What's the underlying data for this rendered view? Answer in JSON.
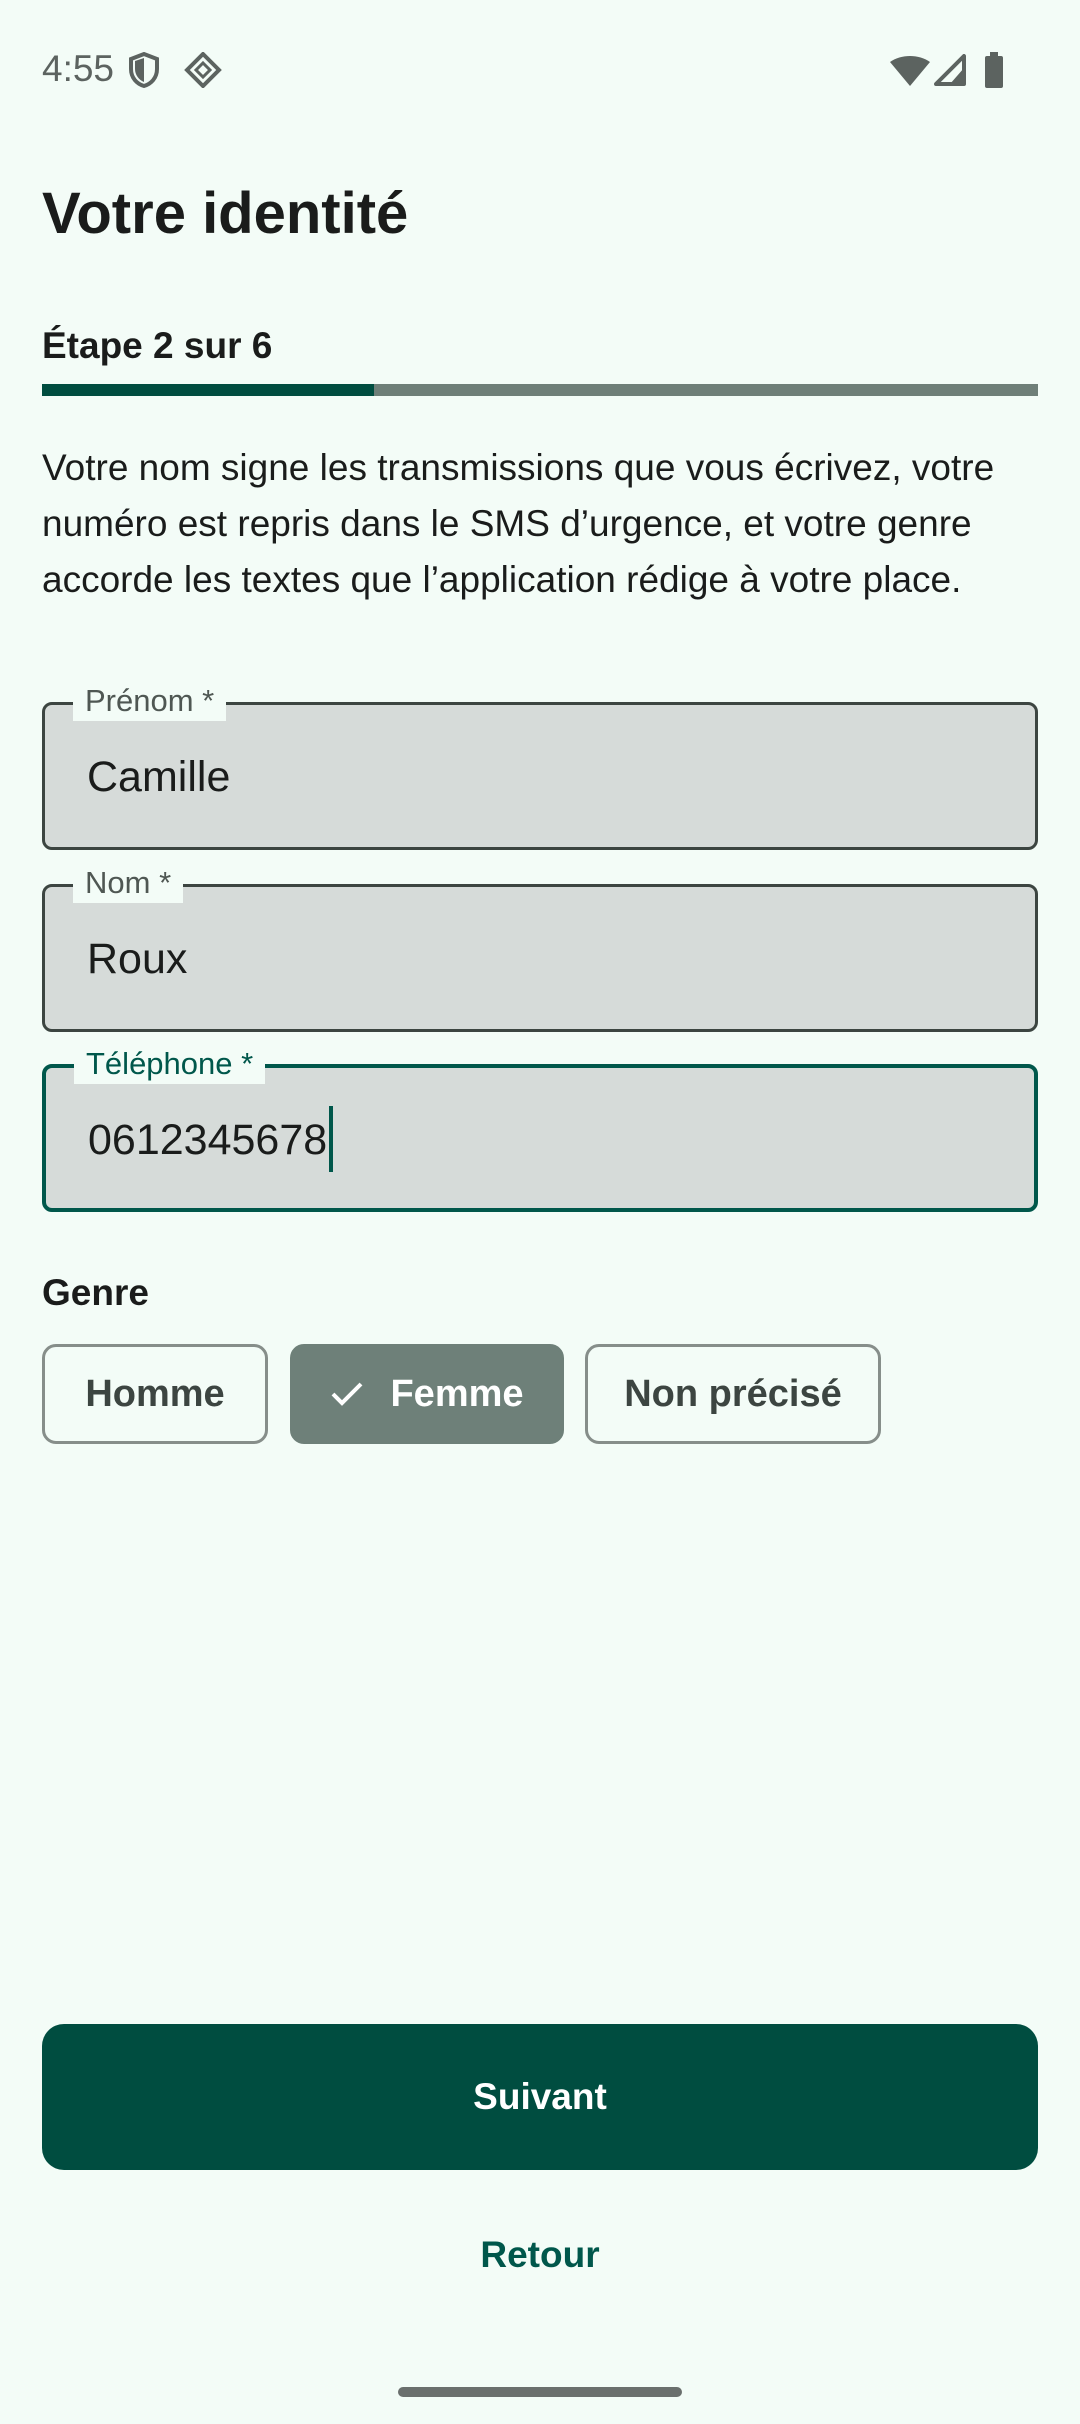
{
  "status_bar": {
    "time": "4:55",
    "icons": [
      "shield-icon",
      "location-diamond-icon",
      "wifi-icon",
      "signal-icon",
      "battery-icon"
    ]
  },
  "header": {
    "title": "Votre identité"
  },
  "stepper": {
    "label": "Étape 2 sur 6",
    "current_step": 2,
    "total_steps": 6
  },
  "intro_text": "Votre nom signe les transmissions que vous écrivez, votre numéro est repris dans le SMS d’urgence, et votre genre accorde les textes que l’application rédige à votre place.",
  "form": {
    "first_name": {
      "label": "Prénom *",
      "value": "Camille"
    },
    "last_name": {
      "label": "Nom *",
      "value": "Roux"
    },
    "phone": {
      "label": "Téléphone *",
      "value": "0612345678",
      "focused": true
    }
  },
  "genre": {
    "label": "Genre",
    "options": [
      {
        "label": "Homme",
        "selected": false
      },
      {
        "label": "Femme",
        "selected": true
      },
      {
        "label": "Non précisé",
        "selected": false
      }
    ]
  },
  "actions": {
    "next_label": "Suivant",
    "back_label": "Retour"
  },
  "colors": {
    "background": "#f3fcf7",
    "primary": "#004d40",
    "progress_track": "#6e7f78",
    "chip_selected": "#6e8079",
    "field_fill": "#d6dbd9"
  }
}
